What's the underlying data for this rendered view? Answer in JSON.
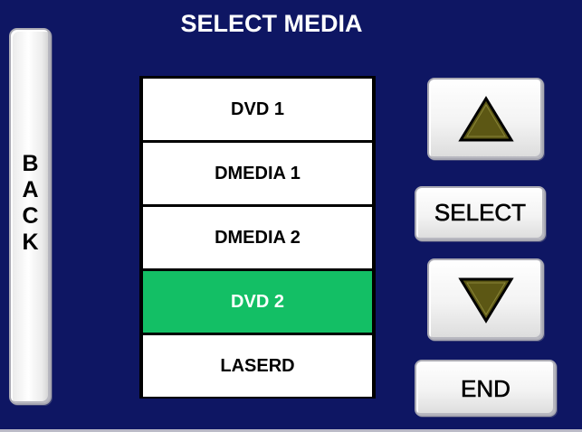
{
  "screen": {
    "title": "SELECT MEDIA"
  },
  "back_button": {
    "letters": [
      "B",
      "A",
      "C",
      "K"
    ]
  },
  "media_list": {
    "items": [
      {
        "label": "DVD 1",
        "selected": false
      },
      {
        "label": "DMEDIA 1",
        "selected": false
      },
      {
        "label": "DMEDIA 2",
        "selected": false
      },
      {
        "label": "DVD 2",
        "selected": true
      },
      {
        "label": "LASERD",
        "selected": false
      }
    ]
  },
  "controls": {
    "up_icon": "triangle-up-icon",
    "down_icon": "triangle-down-icon",
    "select_label": "SELECT",
    "end_label": "END"
  },
  "colors": {
    "background": "#0e1663",
    "selected_item": "#13bf65",
    "arrow_fill": "#5c5714"
  }
}
